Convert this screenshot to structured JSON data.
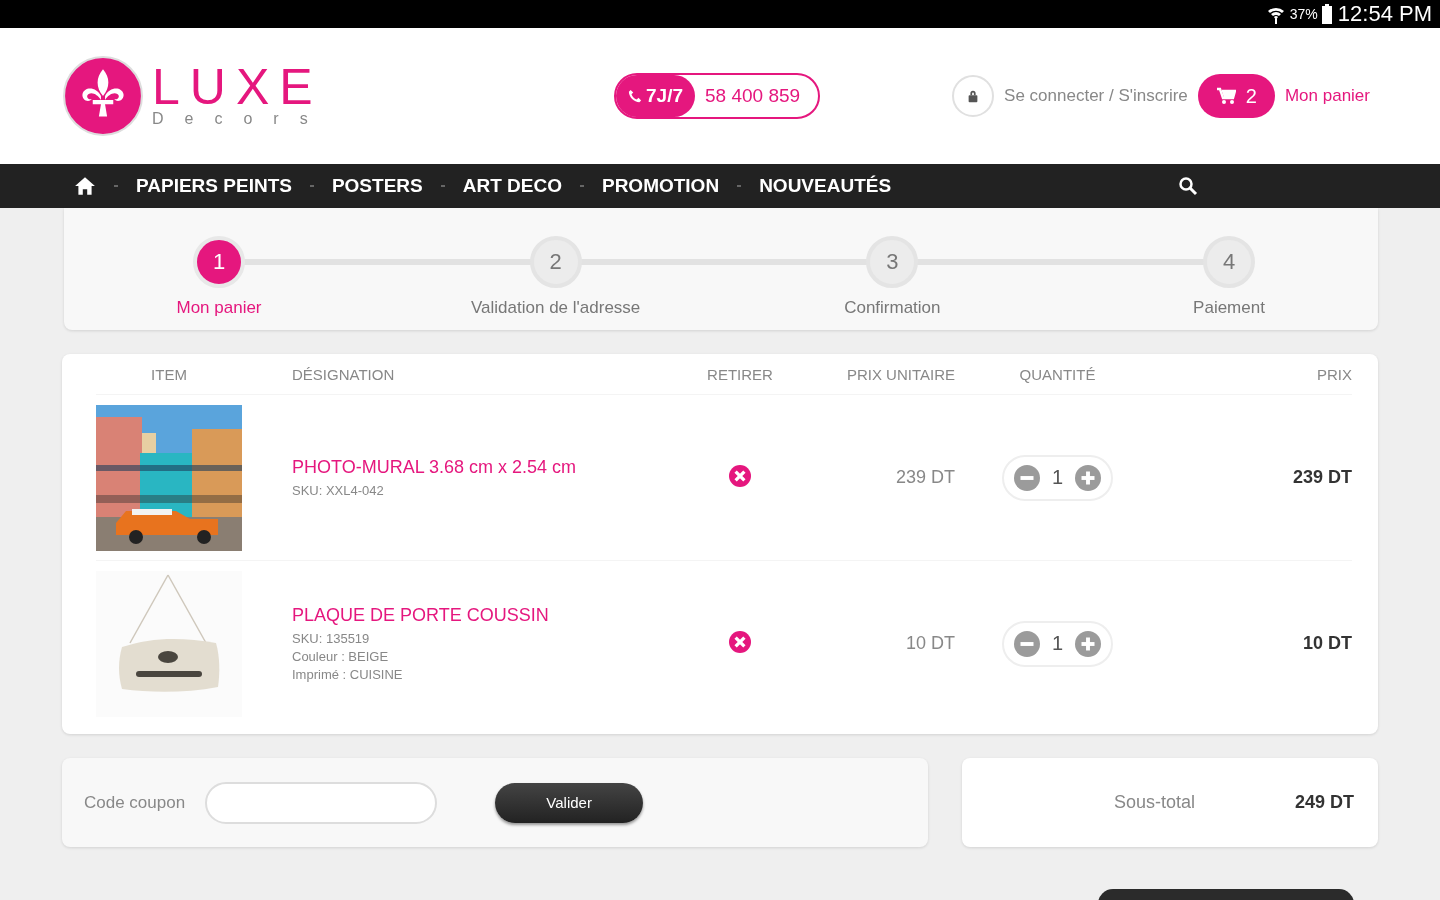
{
  "status_bar": {
    "battery": "37%",
    "time": "12:54 PM"
  },
  "header": {
    "logo": {
      "name": "LUXE",
      "tagline": "Decors"
    },
    "phone": {
      "badge": "7J/7",
      "number": "58 400 859"
    },
    "login": "Se connecter / S'inscrire",
    "cart": {
      "count": "2",
      "label": "Mon panier"
    }
  },
  "nav": {
    "items": [
      "PAPIERS PEINTS",
      "POSTERS",
      "ART DECO",
      "PROMOTION",
      "NOUVEAUTÉS"
    ]
  },
  "steps": [
    {
      "number": "1",
      "label": "Mon panier",
      "selected": true
    },
    {
      "number": "2",
      "label": "Validation de l'adresse",
      "selected": false
    },
    {
      "number": "3",
      "label": "Confirmation",
      "selected": false
    },
    {
      "number": "4",
      "label": "Paiement",
      "selected": false
    }
  ],
  "cart": {
    "columns": [
      "ITEM",
      "DÉSIGNATION",
      "RETIRER",
      "PRIX UNITAIRE",
      "QUANTITÉ",
      "PRIX"
    ],
    "rows": [
      {
        "kind": "mural",
        "picture": {
          "kind": "picture"
        },
        "name": "PHOTO-MURAL 3.68 cm x 2.54 cm",
        "details": [
          "SKU: XXL4-042"
        ],
        "unit_price": "239 DT",
        "quantity": "1",
        "price": "239 DT"
      },
      {
        "kind": "cushion",
        "picture": {
          "kind": "picture"
        },
        "name": "PLAQUE DE PORTE COUSSIN",
        "details": [
          "SKU: 135519",
          "Couleur : BEIGE",
          "Imprimé : CUISINE"
        ],
        "unit_price": "10 DT",
        "quantity": "1",
        "price": "10 DT"
      }
    ]
  },
  "coupon": {
    "label": "Code coupon",
    "button": "Valider"
  },
  "summary": {
    "label": "Sous-total",
    "value": "249 DT"
  }
}
